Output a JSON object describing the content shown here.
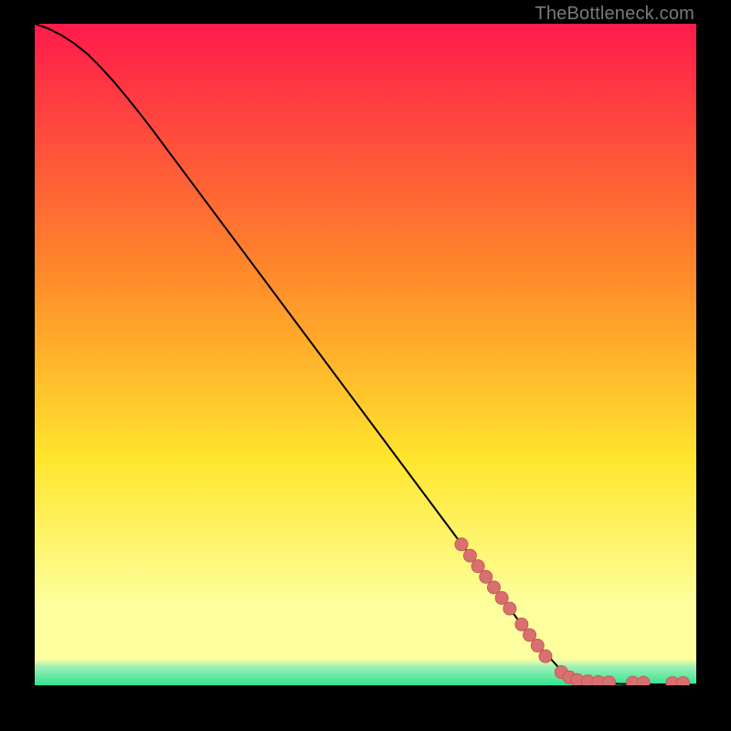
{
  "watermark": "TheBottleneck.com",
  "colors": {
    "gradient_top": "#ff1a4b",
    "gradient_mid1": "#ff8a2a",
    "gradient_mid2": "#ffe62e",
    "gradient_mid3": "#fdff9e",
    "gradient_bottom_band": "#2fe28f",
    "curve": "#000000",
    "marker_fill": "#d87070",
    "marker_stroke": "#c75a5a"
  },
  "chart_data": {
    "type": "line",
    "title": "",
    "xlabel": "",
    "ylabel": "",
    "xlim": [
      0,
      100
    ],
    "ylim": [
      0,
      100
    ],
    "grid": false,
    "legend": false,
    "series": [
      {
        "name": "bottleneck-curve",
        "x": [
          0,
          2,
          4,
          6,
          8,
          10,
          12,
          14,
          16,
          18,
          20,
          25,
          30,
          35,
          40,
          45,
          50,
          55,
          60,
          65,
          70,
          75,
          80,
          82,
          84,
          86,
          88,
          90,
          92,
          94,
          96,
          98,
          100
        ],
        "y": [
          100,
          99.3,
          98.3,
          97.0,
          95.4,
          93.4,
          91.2,
          88.8,
          86.3,
          83.7,
          81.0,
          74.3,
          67.6,
          60.9,
          54.2,
          47.5,
          40.8,
          34.1,
          27.4,
          20.7,
          14.0,
          7.3,
          1.8,
          0.9,
          0.5,
          0.3,
          0.22,
          0.18,
          0.15,
          0.13,
          0.12,
          0.11,
          0.1
        ]
      }
    ],
    "markers": {
      "name": "highlighted-points",
      "points": [
        {
          "x": 64.5,
          "y": 21.3
        },
        {
          "x": 65.8,
          "y": 19.6
        },
        {
          "x": 67.0,
          "y": 18.0
        },
        {
          "x": 68.2,
          "y": 16.4
        },
        {
          "x": 69.4,
          "y": 14.8
        },
        {
          "x": 70.6,
          "y": 13.2
        },
        {
          "x": 71.8,
          "y": 11.6
        },
        {
          "x": 73.6,
          "y": 9.2
        },
        {
          "x": 74.8,
          "y": 7.6
        },
        {
          "x": 76.0,
          "y": 6.0
        },
        {
          "x": 77.2,
          "y": 4.4
        },
        {
          "x": 79.6,
          "y": 2.0
        },
        {
          "x": 80.8,
          "y": 1.2
        },
        {
          "x": 82.0,
          "y": 0.8
        },
        {
          "x": 83.6,
          "y": 0.6
        },
        {
          "x": 85.2,
          "y": 0.5
        },
        {
          "x": 86.8,
          "y": 0.45
        },
        {
          "x": 90.4,
          "y": 0.4
        },
        {
          "x": 92.0,
          "y": 0.38
        },
        {
          "x": 96.4,
          "y": 0.35
        },
        {
          "x": 98.0,
          "y": 0.34
        }
      ]
    }
  }
}
